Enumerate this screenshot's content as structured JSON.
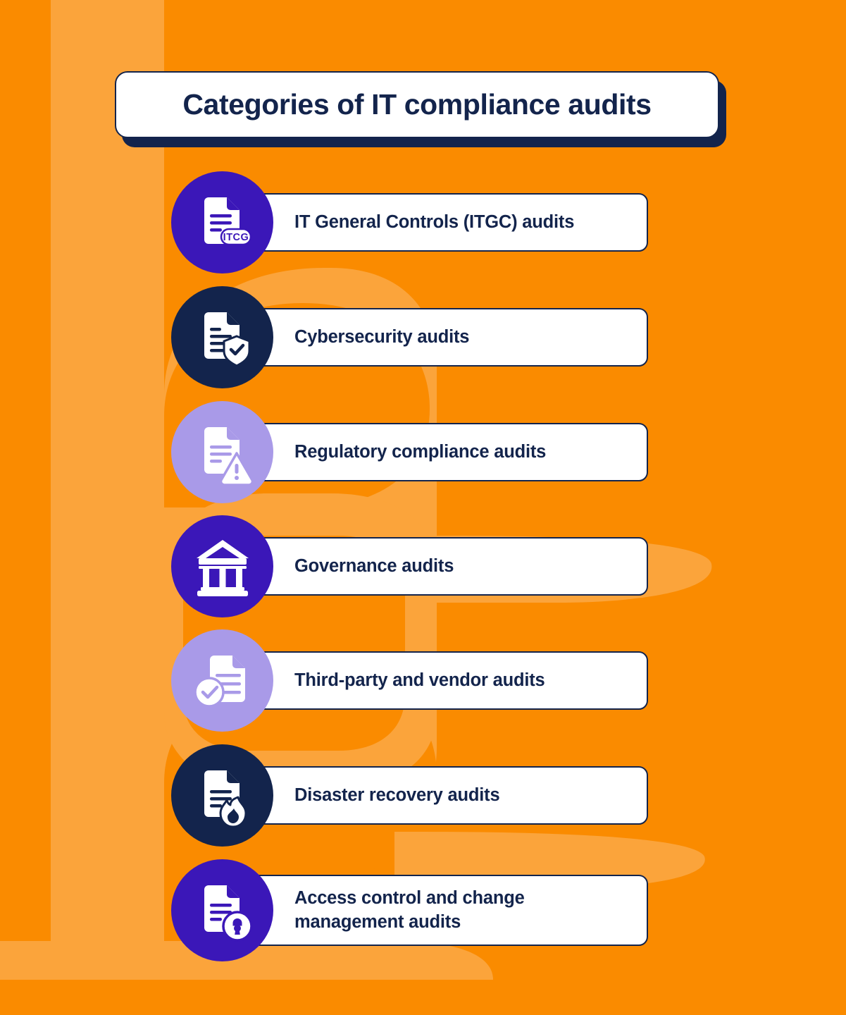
{
  "title": {
    "text": "Categories of IT compliance audits"
  },
  "colors": {
    "background_orange": "#FA8B00",
    "background_orange_light": "#FBA43B",
    "navy": "#13244C",
    "indigo": "#3B17B8",
    "lavender": "#A99AE8",
    "white": "#FFFFFF"
  },
  "items": [
    {
      "label": "IT General Controls (ITGC) audits",
      "icon": "document-itcg-badge-icon",
      "circle_color": "#3B17B8",
      "badge_text": "ITCG",
      "two_line": false
    },
    {
      "label": "Cybersecurity audits",
      "icon": "document-shield-check-icon",
      "circle_color": "#13244C",
      "two_line": false
    },
    {
      "label": "Regulatory compliance audits",
      "icon": "document-warning-triangle-icon",
      "circle_color": "#A99AE8",
      "two_line": false
    },
    {
      "label": "Governance audits",
      "icon": "bank-building-columns-icon",
      "circle_color": "#3B17B8",
      "two_line": false
    },
    {
      "label": "Third-party and vendor audits",
      "icon": "document-check-circle-icon",
      "circle_color": "#A99AE8",
      "two_line": false
    },
    {
      "label": "Disaster recovery audits",
      "icon": "document-flame-icon",
      "circle_color": "#13244C",
      "two_line": false
    },
    {
      "label": "Access control and change management audits",
      "icon": "document-lock-icon",
      "circle_color": "#3B17B8",
      "two_line": true
    }
  ]
}
